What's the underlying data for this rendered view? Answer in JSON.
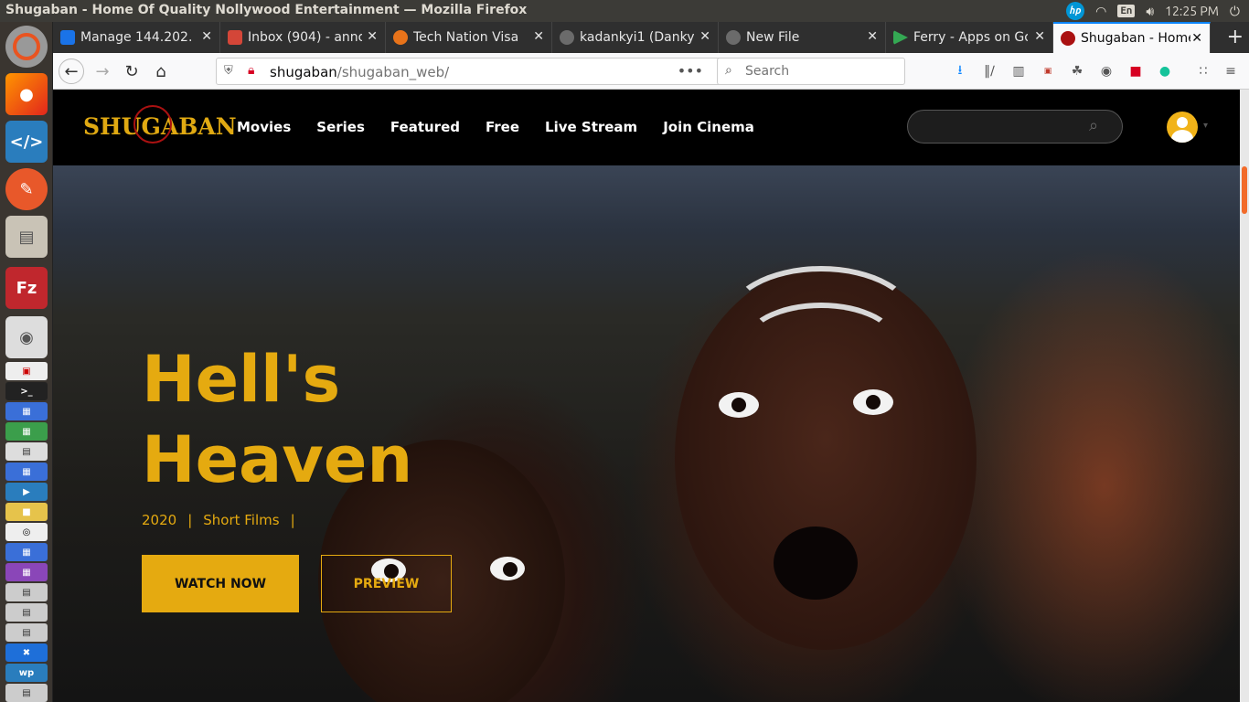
{
  "system": {
    "window_title": "Shugaban - Home Of Quality Nollywood Entertainment — Mozilla Firefox",
    "brand_icon": "hp-icon",
    "keyboard_layout": "En",
    "clock": "12:25 PM"
  },
  "tabs": [
    {
      "label": "Manage 144.202.",
      "favicon": "#1a73e8"
    },
    {
      "label": "Inbox (904) - anno",
      "favicon": "#d44638"
    },
    {
      "label": "Tech Nation Visa",
      "favicon": "#e8731a"
    },
    {
      "label": "kadankyi1 (Danky",
      "favicon": "#6b6b6b"
    },
    {
      "label": "New File",
      "favicon": "#6b6b6b"
    },
    {
      "label": "Ferry - Apps on Go",
      "favicon": "#34a853"
    },
    {
      "label": "Shugaban - Home",
      "favicon": "#a11",
      "active": true
    }
  ],
  "navbar": {
    "url_host": "shugaban",
    "url_path": "/shugaban_web/",
    "search_placeholder": "Search"
  },
  "site": {
    "logo": "SHUGABAN",
    "menu": [
      "Movies",
      "Series",
      "Featured",
      "Free",
      "Live Stream",
      "Join Cinema"
    ],
    "accent_color": "#e5aa10"
  },
  "hero": {
    "title_line1": "Hell's",
    "title_line2": "Heaven",
    "year": "2020",
    "separator": "|",
    "genre": "Short Films",
    "watch_label": "WATCH NOW",
    "preview_label": "PREVIEW"
  }
}
